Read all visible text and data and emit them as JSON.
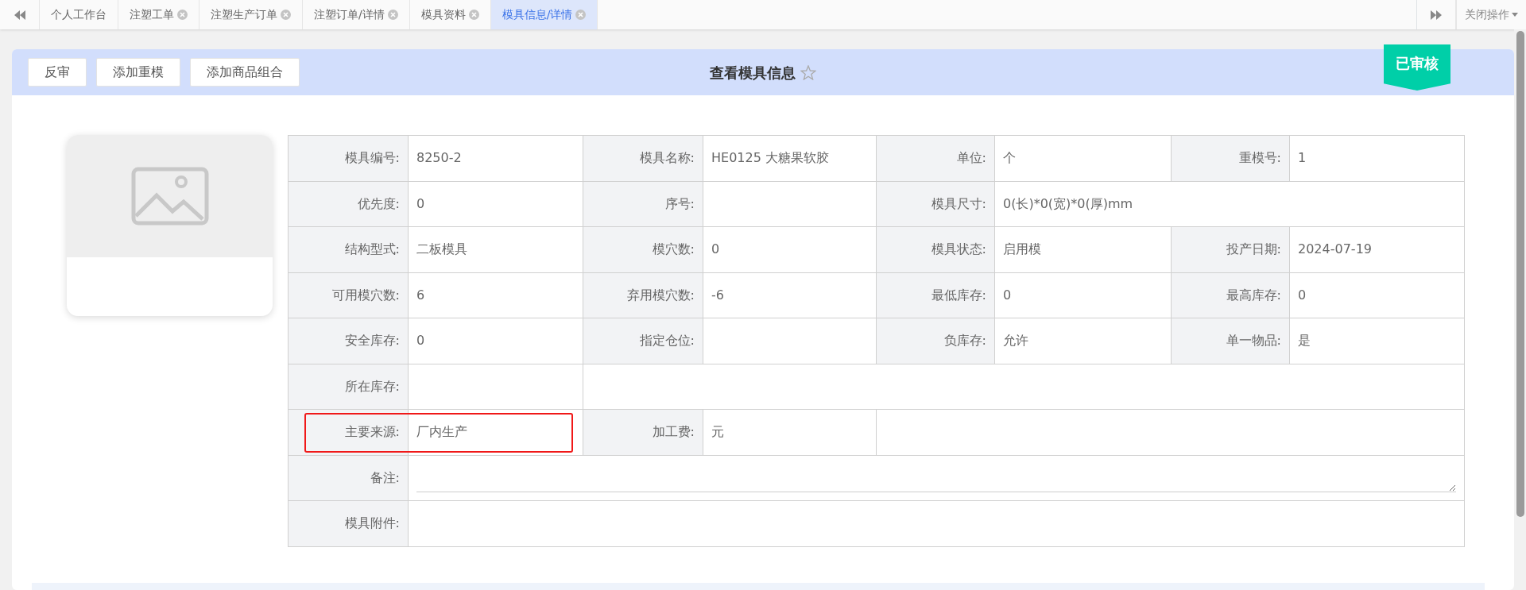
{
  "tabs": [
    {
      "label": "个人工作台",
      "closable": false,
      "selected": false
    },
    {
      "label": "注塑工单",
      "closable": true,
      "selected": false
    },
    {
      "label": "注塑生产订单",
      "closable": true,
      "selected": false
    },
    {
      "label": "注塑订单/详情",
      "closable": true,
      "selected": false
    },
    {
      "label": "模具资料",
      "closable": true,
      "selected": false
    },
    {
      "label": "模具信息/详情",
      "closable": true,
      "selected": true
    }
  ],
  "close_menu": {
    "label": "关闭操作"
  },
  "toolbar": {
    "buttons": [
      "反审",
      "添加重模",
      "添加商品组合"
    ],
    "title": "查看模具信息",
    "status": "已审核"
  },
  "rows": [
    {
      "fields": [
        {
          "kind": "text",
          "label": "模具编号:",
          "value": "8250-2"
        },
        {
          "kind": "text",
          "label": "模具名称:",
          "value": "HE0125 大糖果软胶"
        },
        {
          "kind": "text",
          "label": "单位:",
          "value": "个"
        },
        {
          "kind": "text",
          "label": "重模号:",
          "value": "1"
        }
      ]
    },
    {
      "fields": [
        {
          "kind": "text",
          "label": "优先度:",
          "value": "0"
        },
        {
          "kind": "text",
          "label": "序号:"
        },
        {
          "kind": "wide",
          "label": "模具尺寸:",
          "value": "0(长)*0(宽)*0(厚)mm"
        }
      ]
    },
    {
      "fields": [
        {
          "kind": "text",
          "label": "结构型式:",
          "value": "二板模具"
        },
        {
          "kind": "text",
          "label": "模穴数:",
          "value": "0"
        },
        {
          "kind": "text",
          "label": "模具状态:",
          "value": "启用模"
        },
        {
          "kind": "text",
          "label": "投产日期:",
          "value": "2024-07-19"
        }
      ]
    },
    {
      "fields": [
        {
          "kind": "text",
          "label": "可用模穴数:",
          "value": "6"
        },
        {
          "kind": "text",
          "label": "弃用模穴数:",
          "value": "-6"
        },
        {
          "kind": "text",
          "label": "最低库存:",
          "value": "0"
        },
        {
          "kind": "text",
          "label": "最高库存:",
          "value": "0"
        }
      ]
    },
    {
      "fields": [
        {
          "kind": "text",
          "label": "安全库存:",
          "value": "0"
        },
        {
          "kind": "text",
          "label": "指定仓位:"
        },
        {
          "kind": "text",
          "label": "负库存:",
          "value": "允许"
        },
        {
          "kind": "text",
          "label": "单一物品:",
          "value": "是"
        }
      ]
    },
    {
      "fields": [
        {
          "kind": "text",
          "label": "所在库存:"
        }
      ]
    },
    {
      "fields": [
        {
          "kind": "text",
          "label": "主要来源:",
          "value": "厂内生产",
          "highlighted": true
        },
        {
          "kind": "text",
          "label": "加工费:",
          "value": "元"
        }
      ]
    },
    {
      "fields": [
        {
          "kind": "textarea",
          "label": "备注:"
        }
      ]
    },
    {
      "fields": [
        {
          "kind": "wide",
          "label": "模具附件:"
        }
      ]
    }
  ]
}
